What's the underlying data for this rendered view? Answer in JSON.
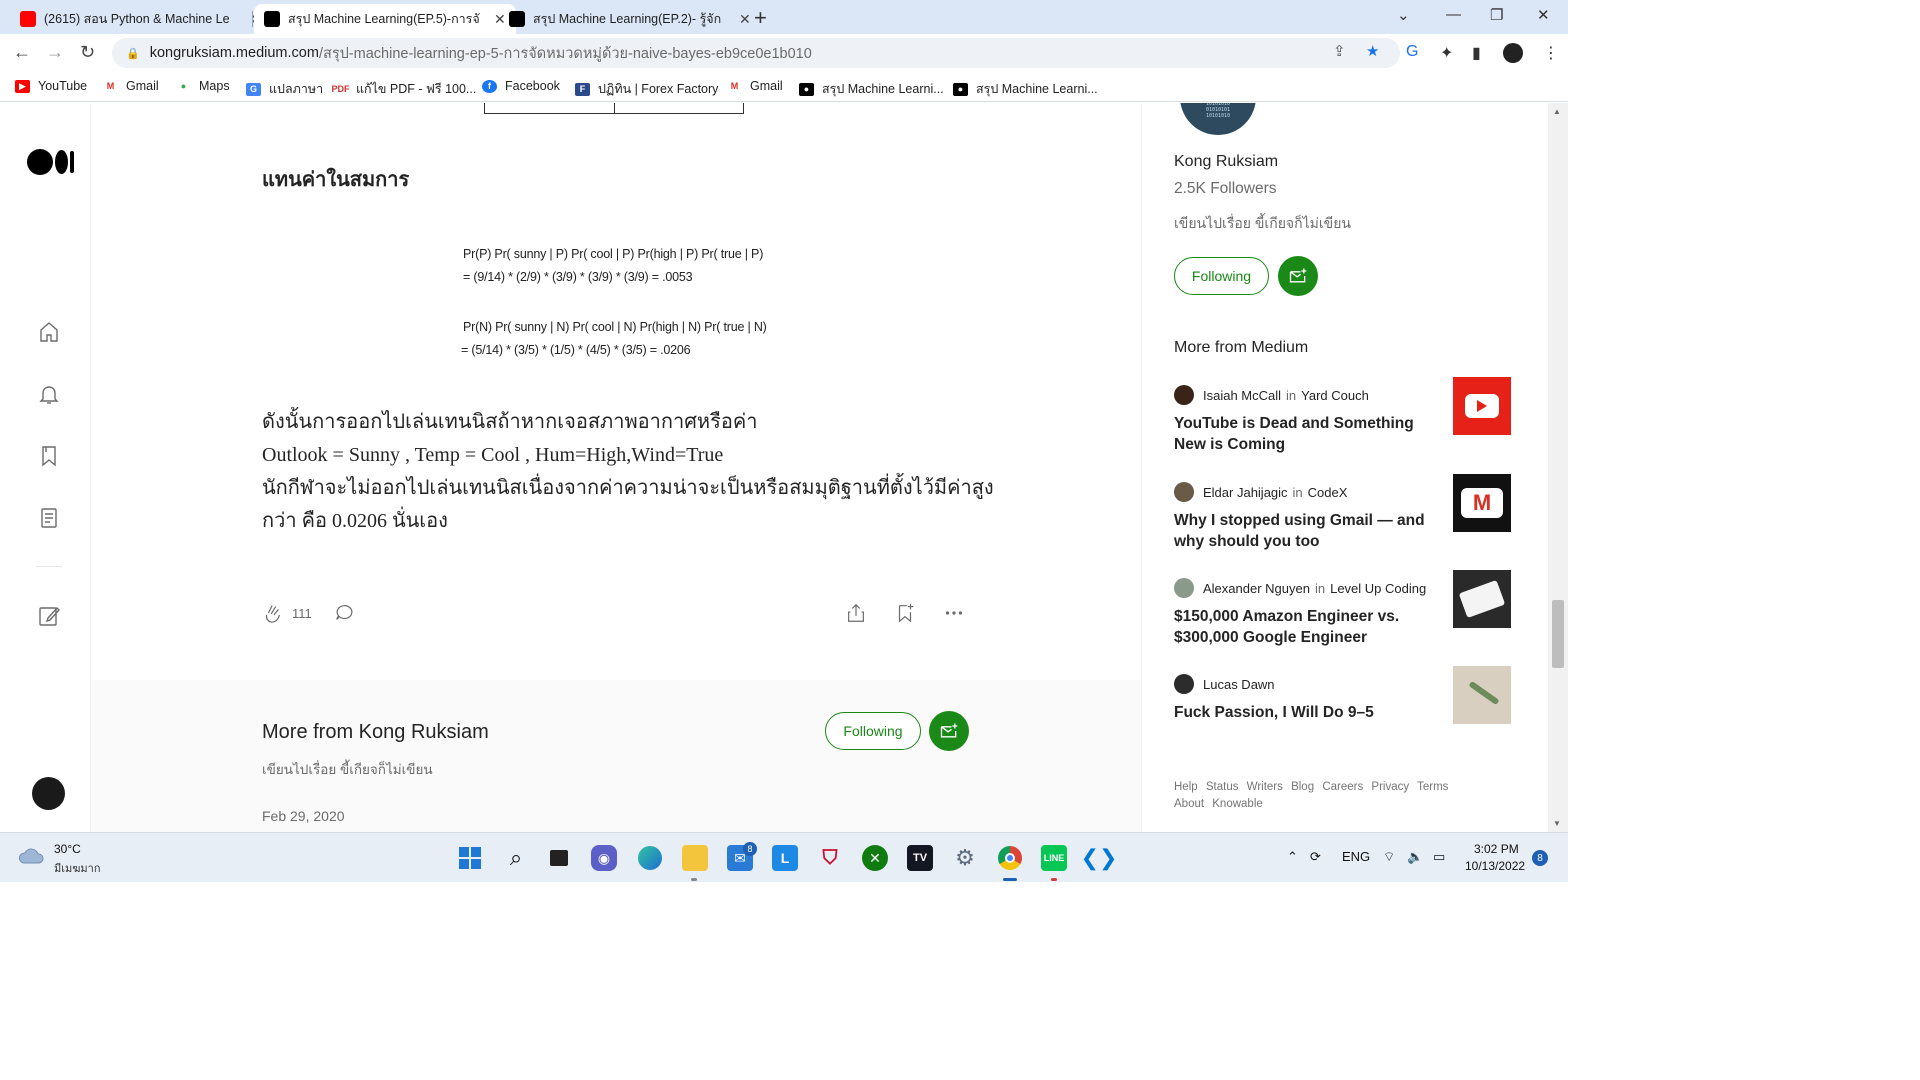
{
  "browser": {
    "tabs": [
      {
        "title": "(2615) สอน Python & Machine Le",
        "favicon": "youtube-icon"
      },
      {
        "title": "สรุป Machine Learning(EP.5)-การจั",
        "favicon": "medium-icon"
      },
      {
        "title": "สรุป Machine Learning(EP.2)- รู้จัก",
        "favicon": "medium-icon"
      }
    ],
    "url_domain": "kongruksiam.medium.com",
    "url_path": "/สรุป-machine-learning-ep-5-การจัดหมวดหมู่ด้วย-naive-bayes-eb9ce0e1b010",
    "bookmarks": [
      "YouTube",
      "Gmail",
      "Maps",
      "แปลภาษา",
      "แก้ไข PDF - ฟรี 100...",
      "Facebook",
      "ปฏิทิน | Forex Factory",
      "Gmail",
      "สรุป Machine Learni...",
      "สรุป Machine Learni..."
    ]
  },
  "article": {
    "subheading": "แทนค่าในสมการ",
    "equations": {
      "p_line1": "Pr(P) Pr( sunny | P) Pr( cool | P) Pr(high | P) Pr( true | P)",
      "p_line2": "=  (9/14) * (2/9) * (3/9) * (3/9) * (3/9) = .0053",
      "n_line1": "Pr(N) Pr( sunny | N) Pr( cool | N) Pr(high | N) Pr( true | N)",
      "n_line2": "=   (5/14) * (3/5) * (1/5) * (4/5) * (3/5) = .0206"
    },
    "paragraph": [
      "ดังนั้นการออกไปเล่นเทนนิสถ้าหากเจอสภาพอากาศหรือค่า",
      "Outlook = Sunny , Temp = Cool , Hum=High,Wind=True",
      "นักกีฬาจะไม่ออกไปเล่นเทนนิสเนื่องจากค่าความน่าจะเป็นหรือสมมุติฐานที่ตั้งไว้มีค่าสูง",
      "กว่า คือ 0.0206 นั่นเอง"
    ],
    "clap_count": "111"
  },
  "more_from_author": {
    "title": "More from Kong Ruksiam",
    "description": "เขียนไปเรื่อย ขี้เกียจก็ไม่เขียน",
    "following_label": "Following",
    "date": "Feb 29, 2020"
  },
  "sidebar": {
    "author_name": "Kong Ruksiam",
    "followers": "2.5K Followers",
    "bio": "เขียนไปเรื่อย ขี้เกียจก็ไม่เขียน",
    "following_label": "Following",
    "more_from_medium_title": "More from Medium",
    "recommendations": [
      {
        "author": "Isaiah McCall",
        "in": "in",
        "publication": "Yard Couch",
        "title": "YouTube is Dead and Something New is Coming"
      },
      {
        "author": "Eldar Jahijagic",
        "in": "in",
        "publication": "CodeX",
        "title": "Why I stopped using Gmail — and why should you too"
      },
      {
        "author": "Alexander Nguyen",
        "in": "in",
        "publication": "Level Up Coding",
        "title": "$150,000 Amazon Engineer vs. $300,000 Google Engineer"
      },
      {
        "author": "Lucas Dawn",
        "in": "",
        "publication": "",
        "title": "Fuck Passion, I Will Do 9–5"
      }
    ],
    "footer_links": [
      "Help",
      "Status",
      "Writers",
      "Blog",
      "Careers",
      "Privacy",
      "Terms",
      "About",
      "Knowable"
    ]
  },
  "taskbar": {
    "temperature": "30°C",
    "weather": "มีเมฆมาก",
    "mail_badge": "8",
    "language": "ENG",
    "time": "3:02 PM",
    "date": "10/13/2022",
    "notifications": "8"
  },
  "colors": {
    "medium_green": "#1a8917",
    "chrome_tabstrip": "#dbe6f6",
    "taskbar": "#e8eef6"
  }
}
